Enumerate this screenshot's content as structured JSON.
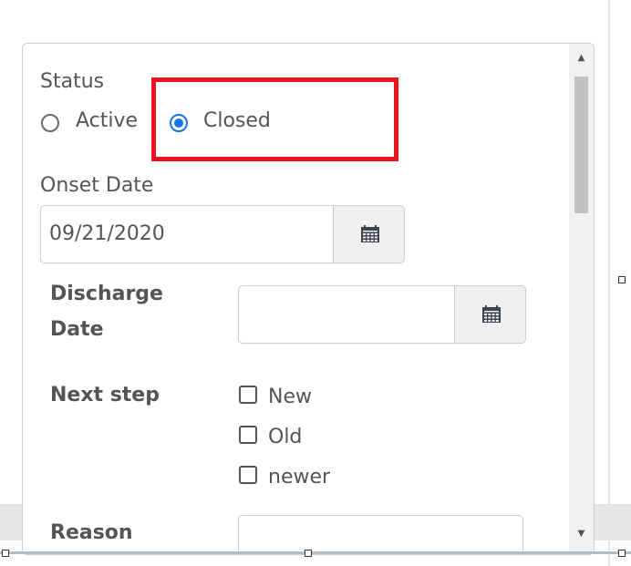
{
  "form": {
    "status_label": "Status",
    "status_options": [
      "Active",
      "Closed"
    ],
    "status_selected": "Closed",
    "onset_date_label": "Onset Date",
    "onset_date_value": "09/21/2020",
    "discharge_label_line1": "Discharge",
    "discharge_label_line2": "Date",
    "discharge_date_value": "",
    "next_step_label": "Next step",
    "next_step_options": [
      "New",
      "Old",
      "newer"
    ],
    "next_step_checked": [],
    "reason_label": "Reason",
    "reason_value": ""
  },
  "icons": {
    "calendar": "calendar-icon",
    "scroll_up": "scroll-up-arrow-icon",
    "scroll_down": "scroll-down-arrow-icon"
  },
  "colors": {
    "highlight": "#e8141f",
    "radio_selected": "#1a73e8",
    "text": "#555555"
  }
}
